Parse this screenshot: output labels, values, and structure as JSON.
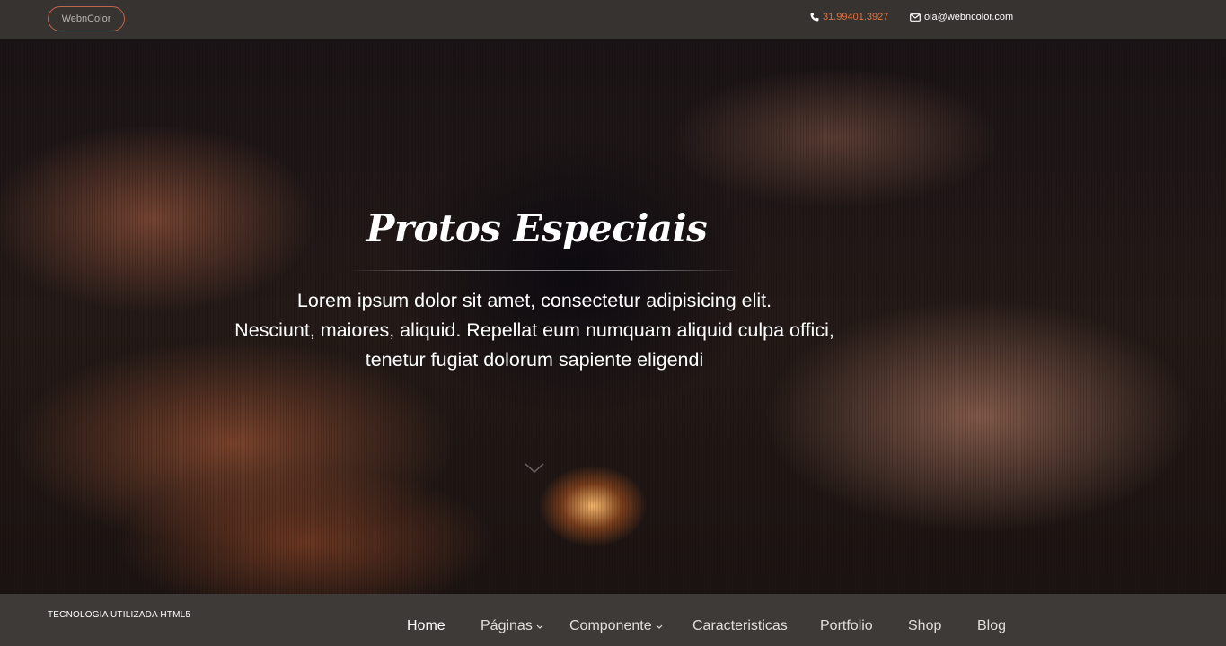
{
  "header": {
    "logo": "WebnColor",
    "phone": "31.99401.3927",
    "email": "ola@webncolor.com"
  },
  "hero": {
    "title": "Protos Especiais",
    "text_lines": [
      "Lorem ipsum dolor sit amet, consectetur adipisicing elit.",
      "Nesciunt, maiores, aliquid. Repellat eum numquam aliquid culpa offici,",
      "tenetur fugiat dolorum sapiente eligendi"
    ]
  },
  "footer": {
    "tech_label": "TECNOLOGIA UTILIZADA HTML5",
    "nav": [
      {
        "label": "Home",
        "active": true
      },
      {
        "label": "Páginas",
        "dropdown": true
      },
      {
        "label": "Componente",
        "dropdown": true
      },
      {
        "label": "Caracteristicas"
      },
      {
        "label": "Portfolio"
      },
      {
        "label": "Shop"
      },
      {
        "label": "Blog"
      }
    ]
  },
  "icons": {
    "phone": "phone-icon",
    "email": "envelope-icon",
    "scroll": "chevron-down-icon",
    "dropdown": "chevron-down-icon"
  },
  "colors": {
    "accent": "#e0733f",
    "topbar": "#373331",
    "navbar": "#3e3a37"
  }
}
